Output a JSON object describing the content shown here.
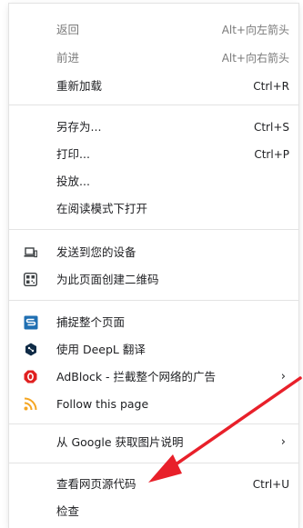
{
  "menu": {
    "items": [
      {
        "label": "返回",
        "shortcut": "Alt+向左箭头"
      },
      {
        "label": "前进",
        "shortcut": "Alt+向右箭头"
      },
      {
        "label": "重新加载",
        "shortcut": "Ctrl+R"
      },
      {
        "label": "另存为...",
        "shortcut": "Ctrl+S"
      },
      {
        "label": "打印...",
        "shortcut": "Ctrl+P"
      },
      {
        "label": "投放..."
      },
      {
        "label": "在阅读模式下打开"
      },
      {
        "label": "发送到您的设备",
        "icon": "laptop-icon"
      },
      {
        "label": "为此页面创建二维码",
        "icon": "qr-code-icon"
      },
      {
        "label": "捕捉整个页面",
        "icon": "capture-icon"
      },
      {
        "label": "使用 DeepL 翻译",
        "icon": "deepl-icon"
      },
      {
        "label": "AdBlock - 拦截整个网络的广告",
        "icon": "adblock-icon",
        "submenu": "›"
      },
      {
        "label": "Follow this page",
        "icon": "rss-icon"
      },
      {
        "label": "从 Google 获取图片说明",
        "submenu": "›"
      },
      {
        "label": "查看网页源代码",
        "shortcut": "Ctrl+U"
      },
      {
        "label": "检查"
      }
    ]
  },
  "colors": {
    "arrow": "#e8202a",
    "adblock": "#e02020",
    "rss": "#f5a623",
    "capture": "#1f6fb2"
  }
}
